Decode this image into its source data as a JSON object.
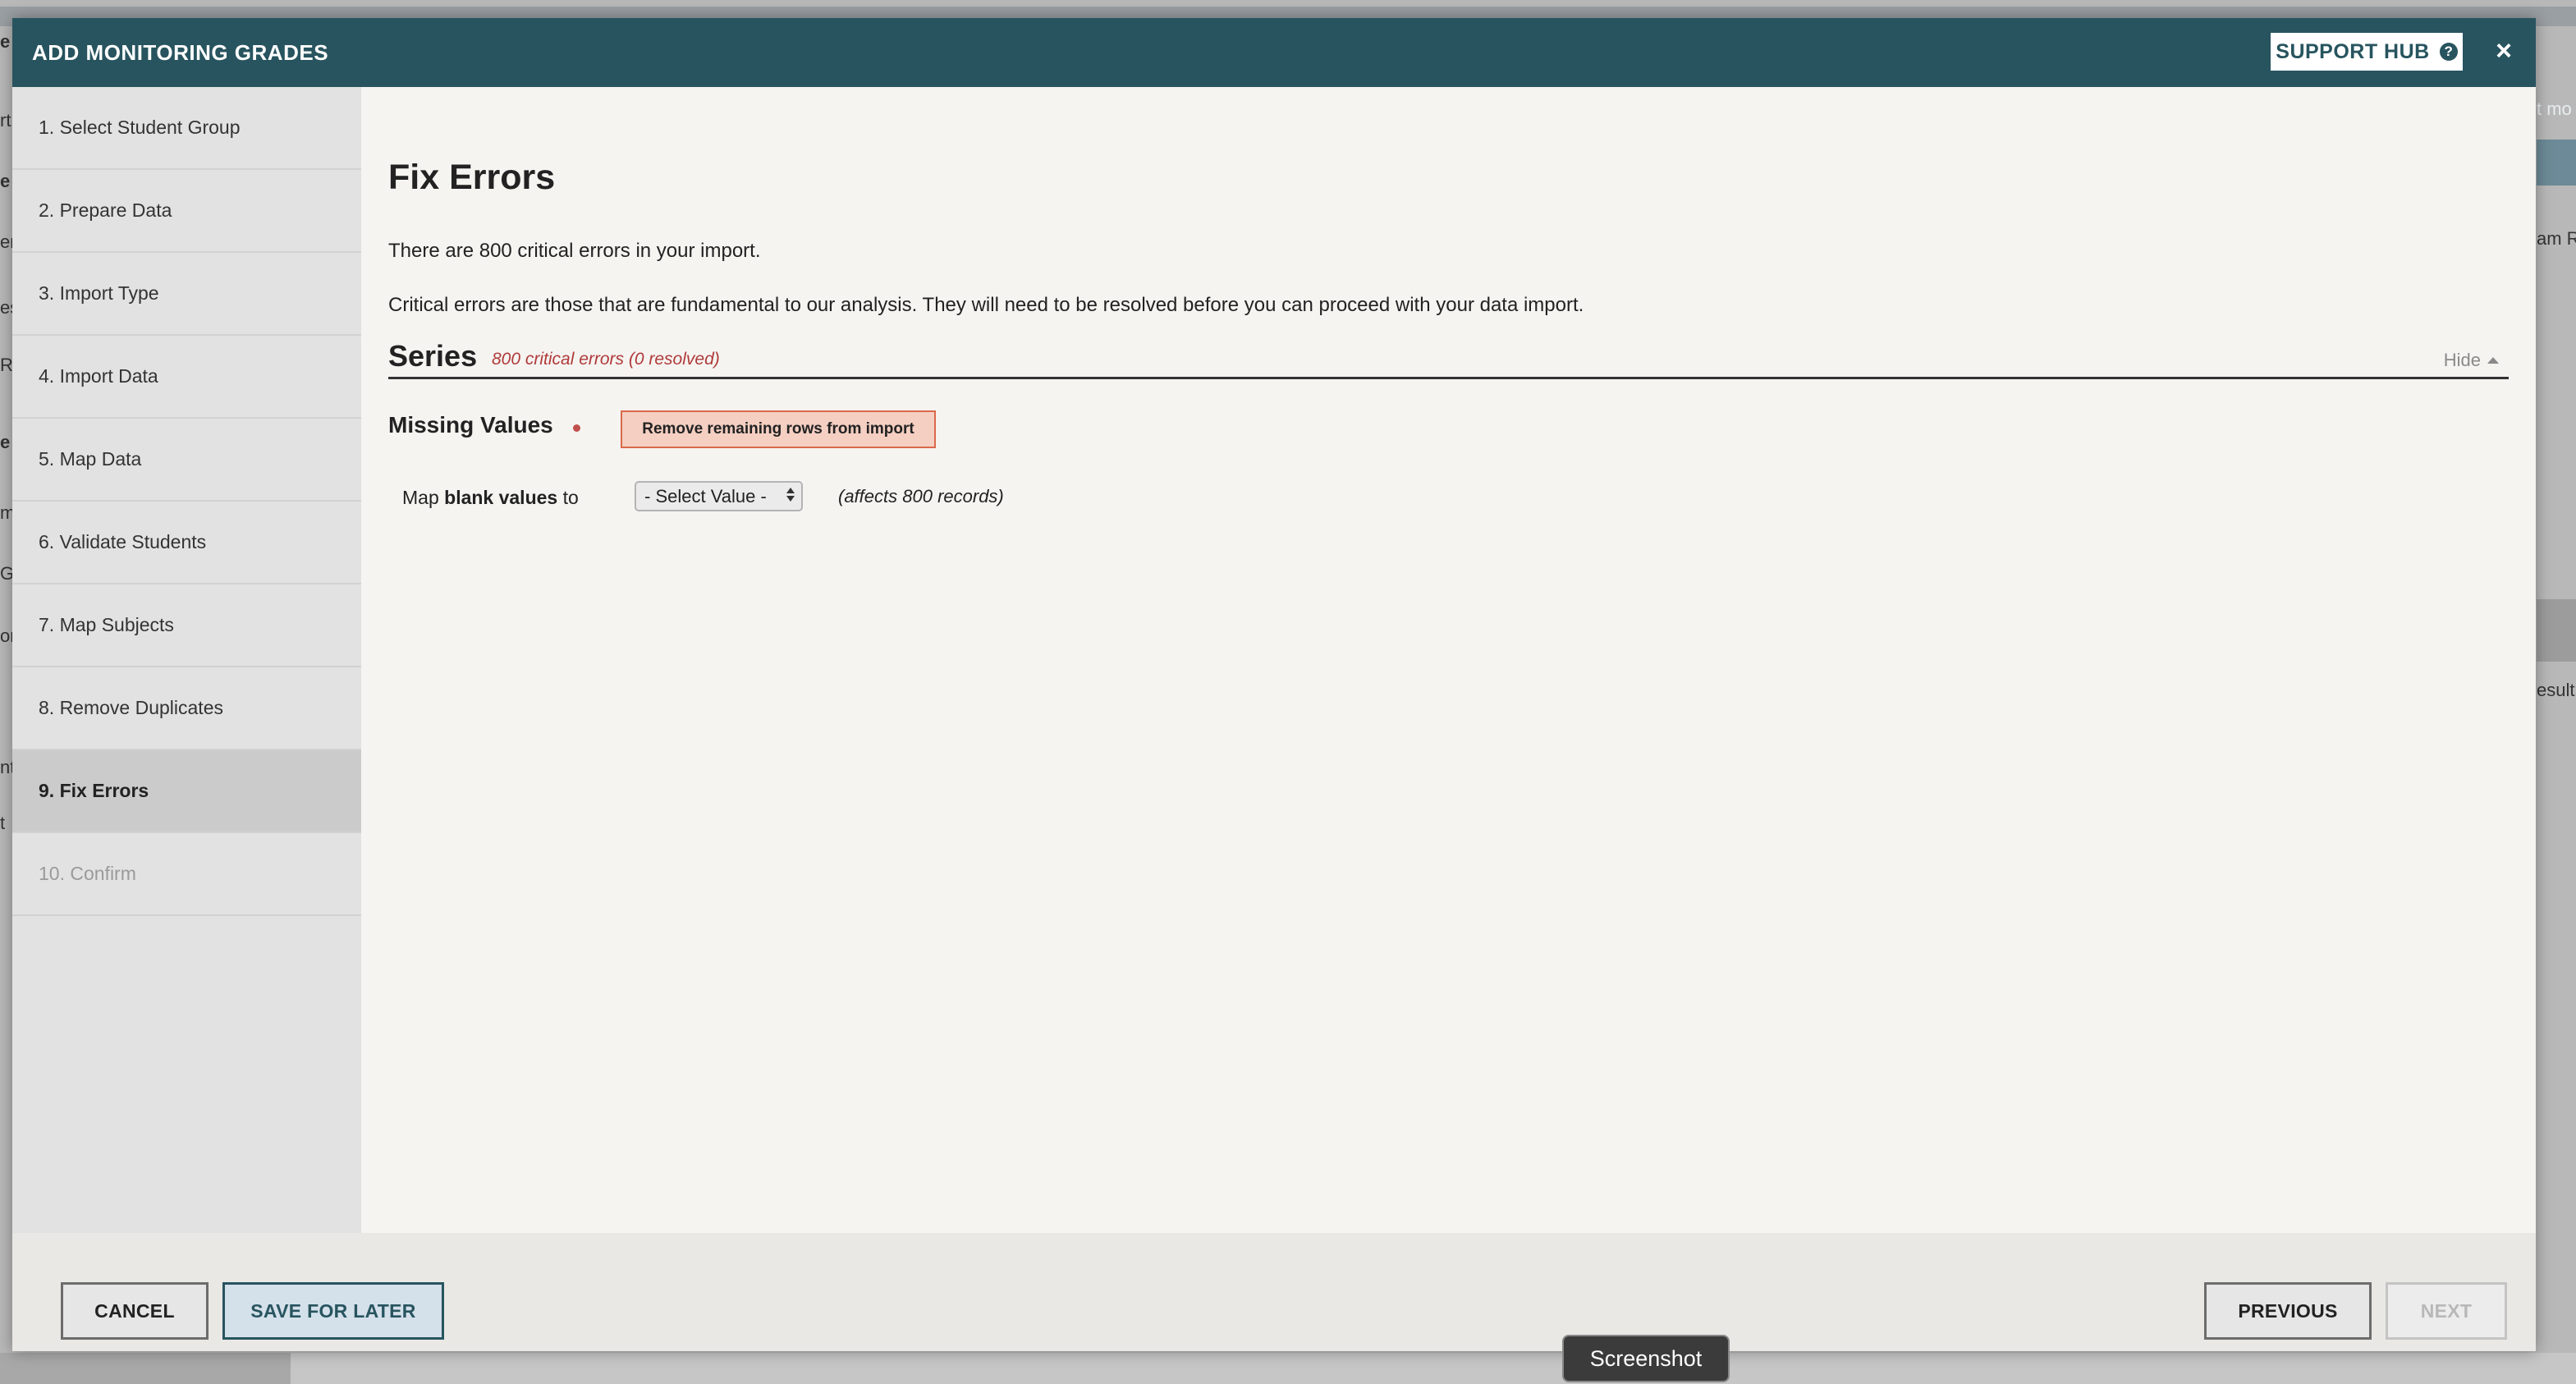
{
  "background_fragments": {
    "left": [
      "e",
      "rt",
      "e",
      "er",
      "es",
      "R",
      "e",
      "m",
      "Gi",
      "or",
      "nt",
      "t"
    ],
    "right_1": "t mo",
    "right_2": "am R",
    "right_3": "esult"
  },
  "modal": {
    "title": "ADD MONITORING GRADES",
    "support_label": "SUPPORT HUB",
    "help_glyph": "?",
    "close_glyph": "×"
  },
  "steps": [
    {
      "label": "1. Select Student Group",
      "state": "normal"
    },
    {
      "label": "2. Prepare Data",
      "state": "normal"
    },
    {
      "label": "3. Import Type",
      "state": "normal"
    },
    {
      "label": "4. Import Data",
      "state": "normal"
    },
    {
      "label": "5. Map Data",
      "state": "normal"
    },
    {
      "label": "6. Validate Students",
      "state": "normal"
    },
    {
      "label": "7. Map Subjects",
      "state": "normal"
    },
    {
      "label": "8. Remove Duplicates",
      "state": "normal"
    },
    {
      "label": "9. Fix Errors",
      "state": "active"
    },
    {
      "label": "10. Confirm",
      "state": "disabled"
    }
  ],
  "main": {
    "title": "Fix Errors",
    "summary": "There are 800 critical errors in your import.",
    "description": "Critical errors are those that are fundamental to our analysis. They will need to be resolved before you can proceed with your data import.",
    "section": {
      "title": "Series",
      "count": "800 critical errors (0 resolved)",
      "hide_label": "Hide"
    },
    "missing_values": {
      "title": "Missing Values",
      "remove_button": "Remove remaining rows from import",
      "map_prefix": "Map",
      "map_bold": "blank values",
      "map_suffix": "to",
      "select_value": "- Select Value -",
      "affects": "(affects 800 records)"
    }
  },
  "footer": {
    "cancel": "CANCEL",
    "save": "SAVE FOR LATER",
    "previous": "PREVIOUS",
    "next": "NEXT"
  },
  "tooltip": "Screenshot",
  "colors": {
    "header": "#27545f",
    "error_text": "#b03a3a",
    "remove_button_bg": "#f5cfc2",
    "remove_button_border": "#d9694a"
  },
  "icons": [
    "help-icon",
    "close-icon",
    "caret-up-icon",
    "select-arrows-icon",
    "required-dot-icon"
  ]
}
